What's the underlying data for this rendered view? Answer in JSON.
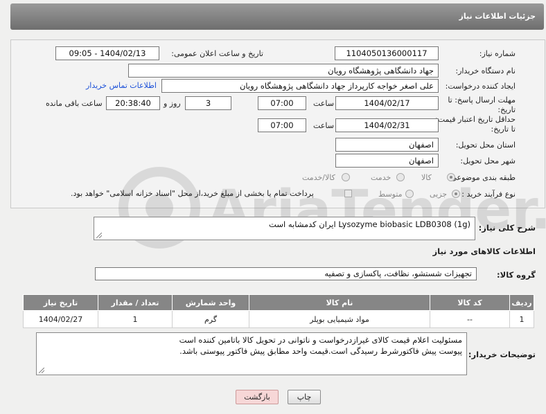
{
  "header": {
    "title": "جزئیات اطلاعات نیاز"
  },
  "fields": {
    "need_number_label": "شماره نیاز:",
    "need_number": "1104050136000117",
    "announce_label": "تاریخ و ساعت اعلان عمومی:",
    "announce_value": "1404/02/13 - 09:05",
    "buyer_org_label": "نام دستگاه خریدار:",
    "buyer_org": "جهاد دانشگاهی پژوهشگاه رویان",
    "requester_label": "ایجاد کننده درخواست:",
    "requester": "علی اصغر خواجه کارپرداز جهاد دانشگاهی پژوهشگاه رویان",
    "contact_link": "اطلاعات تماس خریدار",
    "reply_deadline_label_1": "مهلت ارسال پاسخ: تا",
    "reply_deadline_label_2": "تاریخ:",
    "reply_date": "1404/02/17",
    "time_label": "ساعت",
    "reply_time": "07:00",
    "days_value": "3",
    "days_label": "روز و",
    "remaining_time": "20:38:40",
    "remaining_label": "ساعت باقی مانده",
    "price_validity_label_1": "حداقل تاریخ اعتبار قیمت:",
    "price_validity_label_2": "تا تاریخ:",
    "validity_date": "1404/02/31",
    "validity_time": "07:00",
    "province_label": "استان محل تحویل:",
    "province": "اصفهان",
    "city_label": "شهر محل تحویل:",
    "city": "اصفهان",
    "category_label": "طبقه بندی موضوعی:",
    "category_options": [
      "کالا",
      "خدمت",
      "کالا/خدمت"
    ],
    "process_label": "نوع فرآیند خرید :",
    "process_options": [
      "جزیی",
      "متوسط"
    ],
    "payment_note": "پرداخت تمام یا بخشی از مبلغ خرید،از محل \"اسناد خزانه اسلامی\" خواهد بود."
  },
  "description": {
    "label": "شرح کلی نیاز:",
    "text": "Lysozyme    biobasic   LDB0308  (1g) ایران کدمشابه است"
  },
  "goods": {
    "section_title": "اطلاعات کالاهای مورد نیاز",
    "group_label": "گروه کالا:",
    "group_value": "تجهیزات شستشو، نظافت، پاکسازی و تصفیه"
  },
  "table": {
    "headers": [
      "ردیف",
      "کد کالا",
      "نام کالا",
      "واحد شمارش",
      "تعداد / مقدار",
      "تاریخ نیاز"
    ],
    "rows": [
      {
        "row": "1",
        "code": "--",
        "name": "مواد شیمیایی بوپلر",
        "unit": "گرم",
        "qty": "1",
        "date": "1404/02/27"
      }
    ]
  },
  "buyer_notes": {
    "label": "توضیحات خریدار:",
    "line1": "مسئولیت اعلام قیمت کالای غیرازدرخواست و ناتوانی در تحویل کالا باتامین کننده است",
    "line2": "پیوست پیش فاکتورشرط رسیدگی است.قیمت واحد مطابق پیش فاکتور پیوستی باشد."
  },
  "buttons": {
    "print": "چاپ",
    "back": "بازگشت"
  },
  "watermark": {
    "text": "AriaTender.neT"
  },
  "colors": {
    "header": "#7d7d7d",
    "link": "#1a4fd8",
    "table_header": "#868686",
    "back_button": "#f7d7d7"
  }
}
